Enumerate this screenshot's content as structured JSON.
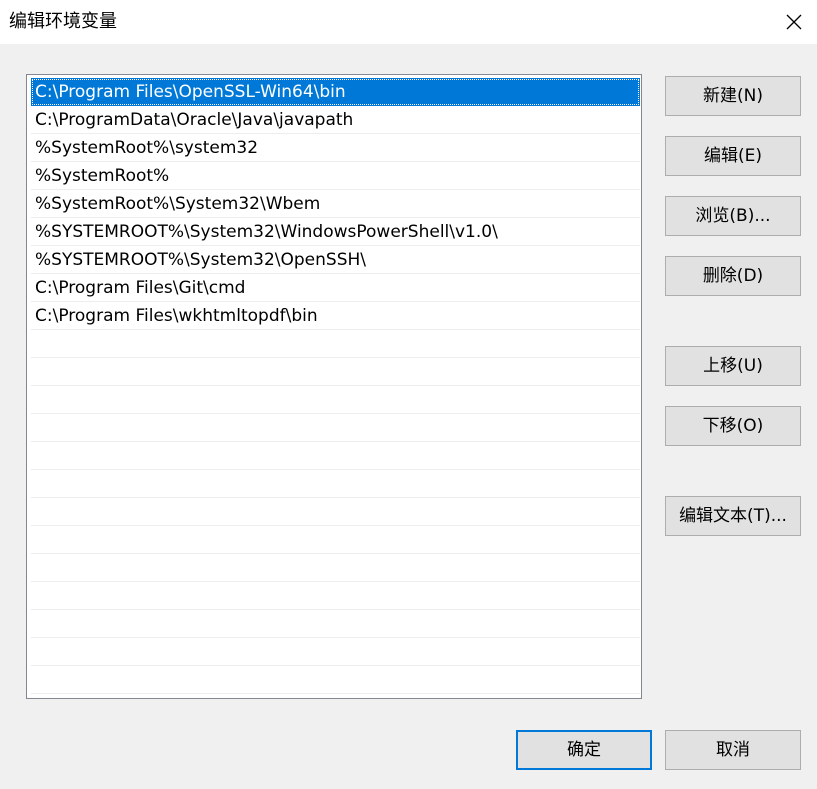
{
  "window": {
    "title": "编辑环境变量"
  },
  "path_list": {
    "selected_index": 0,
    "items": [
      "C:\\Program Files\\OpenSSL-Win64\\bin",
      "C:\\ProgramData\\Oracle\\Java\\javapath",
      "%SystemRoot%\\system32",
      "%SystemRoot%",
      "%SystemRoot%\\System32\\Wbem",
      "%SYSTEMROOT%\\System32\\WindowsPowerShell\\v1.0\\",
      "%SYSTEMROOT%\\System32\\OpenSSH\\",
      "C:\\Program Files\\Git\\cmd",
      "C:\\Program Files\\wkhtmltopdf\\bin",
      "",
      "",
      "",
      "",
      "",
      "",
      "",
      "",
      "",
      "",
      "",
      "",
      ""
    ]
  },
  "buttons": {
    "new": "新建(N)",
    "edit": "编辑(E)",
    "browse": "浏览(B)...",
    "delete": "删除(D)",
    "move_up": "上移(U)",
    "move_down": "下移(O)",
    "edit_text": "编辑文本(T)...",
    "ok": "确定",
    "cancel": "取消"
  },
  "colors": {
    "selection": "#0078d7",
    "dialog_bg": "#f0f0f0",
    "button_bg": "#e1e1e1"
  },
  "icons": {
    "close": "close-icon"
  }
}
